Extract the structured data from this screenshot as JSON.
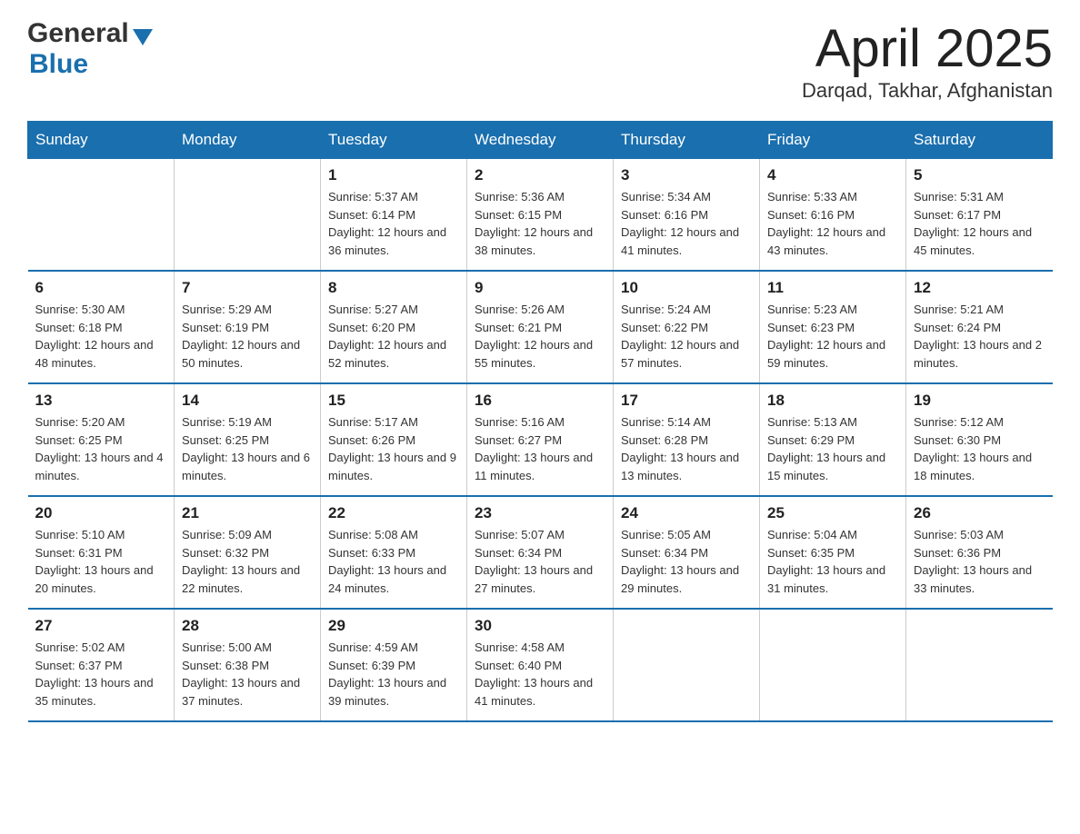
{
  "logo": {
    "general": "General",
    "blue": "Blue"
  },
  "title": {
    "month_year": "April 2025",
    "location": "Darqad, Takhar, Afghanistan"
  },
  "headers": [
    "Sunday",
    "Monday",
    "Tuesday",
    "Wednesday",
    "Thursday",
    "Friday",
    "Saturday"
  ],
  "weeks": [
    [
      {
        "day": "",
        "sunrise": "",
        "sunset": "",
        "daylight": ""
      },
      {
        "day": "",
        "sunrise": "",
        "sunset": "",
        "daylight": ""
      },
      {
        "day": "1",
        "sunrise": "Sunrise: 5:37 AM",
        "sunset": "Sunset: 6:14 PM",
        "daylight": "Daylight: 12 hours and 36 minutes."
      },
      {
        "day": "2",
        "sunrise": "Sunrise: 5:36 AM",
        "sunset": "Sunset: 6:15 PM",
        "daylight": "Daylight: 12 hours and 38 minutes."
      },
      {
        "day": "3",
        "sunrise": "Sunrise: 5:34 AM",
        "sunset": "Sunset: 6:16 PM",
        "daylight": "Daylight: 12 hours and 41 minutes."
      },
      {
        "day": "4",
        "sunrise": "Sunrise: 5:33 AM",
        "sunset": "Sunset: 6:16 PM",
        "daylight": "Daylight: 12 hours and 43 minutes."
      },
      {
        "day": "5",
        "sunrise": "Sunrise: 5:31 AM",
        "sunset": "Sunset: 6:17 PM",
        "daylight": "Daylight: 12 hours and 45 minutes."
      }
    ],
    [
      {
        "day": "6",
        "sunrise": "Sunrise: 5:30 AM",
        "sunset": "Sunset: 6:18 PM",
        "daylight": "Daylight: 12 hours and 48 minutes."
      },
      {
        "day": "7",
        "sunrise": "Sunrise: 5:29 AM",
        "sunset": "Sunset: 6:19 PM",
        "daylight": "Daylight: 12 hours and 50 minutes."
      },
      {
        "day": "8",
        "sunrise": "Sunrise: 5:27 AM",
        "sunset": "Sunset: 6:20 PM",
        "daylight": "Daylight: 12 hours and 52 minutes."
      },
      {
        "day": "9",
        "sunrise": "Sunrise: 5:26 AM",
        "sunset": "Sunset: 6:21 PM",
        "daylight": "Daylight: 12 hours and 55 minutes."
      },
      {
        "day": "10",
        "sunrise": "Sunrise: 5:24 AM",
        "sunset": "Sunset: 6:22 PM",
        "daylight": "Daylight: 12 hours and 57 minutes."
      },
      {
        "day": "11",
        "sunrise": "Sunrise: 5:23 AM",
        "sunset": "Sunset: 6:23 PM",
        "daylight": "Daylight: 12 hours and 59 minutes."
      },
      {
        "day": "12",
        "sunrise": "Sunrise: 5:21 AM",
        "sunset": "Sunset: 6:24 PM",
        "daylight": "Daylight: 13 hours and 2 minutes."
      }
    ],
    [
      {
        "day": "13",
        "sunrise": "Sunrise: 5:20 AM",
        "sunset": "Sunset: 6:25 PM",
        "daylight": "Daylight: 13 hours and 4 minutes."
      },
      {
        "day": "14",
        "sunrise": "Sunrise: 5:19 AM",
        "sunset": "Sunset: 6:25 PM",
        "daylight": "Daylight: 13 hours and 6 minutes."
      },
      {
        "day": "15",
        "sunrise": "Sunrise: 5:17 AM",
        "sunset": "Sunset: 6:26 PM",
        "daylight": "Daylight: 13 hours and 9 minutes."
      },
      {
        "day": "16",
        "sunrise": "Sunrise: 5:16 AM",
        "sunset": "Sunset: 6:27 PM",
        "daylight": "Daylight: 13 hours and 11 minutes."
      },
      {
        "day": "17",
        "sunrise": "Sunrise: 5:14 AM",
        "sunset": "Sunset: 6:28 PM",
        "daylight": "Daylight: 13 hours and 13 minutes."
      },
      {
        "day": "18",
        "sunrise": "Sunrise: 5:13 AM",
        "sunset": "Sunset: 6:29 PM",
        "daylight": "Daylight: 13 hours and 15 minutes."
      },
      {
        "day": "19",
        "sunrise": "Sunrise: 5:12 AM",
        "sunset": "Sunset: 6:30 PM",
        "daylight": "Daylight: 13 hours and 18 minutes."
      }
    ],
    [
      {
        "day": "20",
        "sunrise": "Sunrise: 5:10 AM",
        "sunset": "Sunset: 6:31 PM",
        "daylight": "Daylight: 13 hours and 20 minutes."
      },
      {
        "day": "21",
        "sunrise": "Sunrise: 5:09 AM",
        "sunset": "Sunset: 6:32 PM",
        "daylight": "Daylight: 13 hours and 22 minutes."
      },
      {
        "day": "22",
        "sunrise": "Sunrise: 5:08 AM",
        "sunset": "Sunset: 6:33 PM",
        "daylight": "Daylight: 13 hours and 24 minutes."
      },
      {
        "day": "23",
        "sunrise": "Sunrise: 5:07 AM",
        "sunset": "Sunset: 6:34 PM",
        "daylight": "Daylight: 13 hours and 27 minutes."
      },
      {
        "day": "24",
        "sunrise": "Sunrise: 5:05 AM",
        "sunset": "Sunset: 6:34 PM",
        "daylight": "Daylight: 13 hours and 29 minutes."
      },
      {
        "day": "25",
        "sunrise": "Sunrise: 5:04 AM",
        "sunset": "Sunset: 6:35 PM",
        "daylight": "Daylight: 13 hours and 31 minutes."
      },
      {
        "day": "26",
        "sunrise": "Sunrise: 5:03 AM",
        "sunset": "Sunset: 6:36 PM",
        "daylight": "Daylight: 13 hours and 33 minutes."
      }
    ],
    [
      {
        "day": "27",
        "sunrise": "Sunrise: 5:02 AM",
        "sunset": "Sunset: 6:37 PM",
        "daylight": "Daylight: 13 hours and 35 minutes."
      },
      {
        "day": "28",
        "sunrise": "Sunrise: 5:00 AM",
        "sunset": "Sunset: 6:38 PM",
        "daylight": "Daylight: 13 hours and 37 minutes."
      },
      {
        "day": "29",
        "sunrise": "Sunrise: 4:59 AM",
        "sunset": "Sunset: 6:39 PM",
        "daylight": "Daylight: 13 hours and 39 minutes."
      },
      {
        "day": "30",
        "sunrise": "Sunrise: 4:58 AM",
        "sunset": "Sunset: 6:40 PM",
        "daylight": "Daylight: 13 hours and 41 minutes."
      },
      {
        "day": "",
        "sunrise": "",
        "sunset": "",
        "daylight": ""
      },
      {
        "day": "",
        "sunrise": "",
        "sunset": "",
        "daylight": ""
      },
      {
        "day": "",
        "sunrise": "",
        "sunset": "",
        "daylight": ""
      }
    ]
  ]
}
